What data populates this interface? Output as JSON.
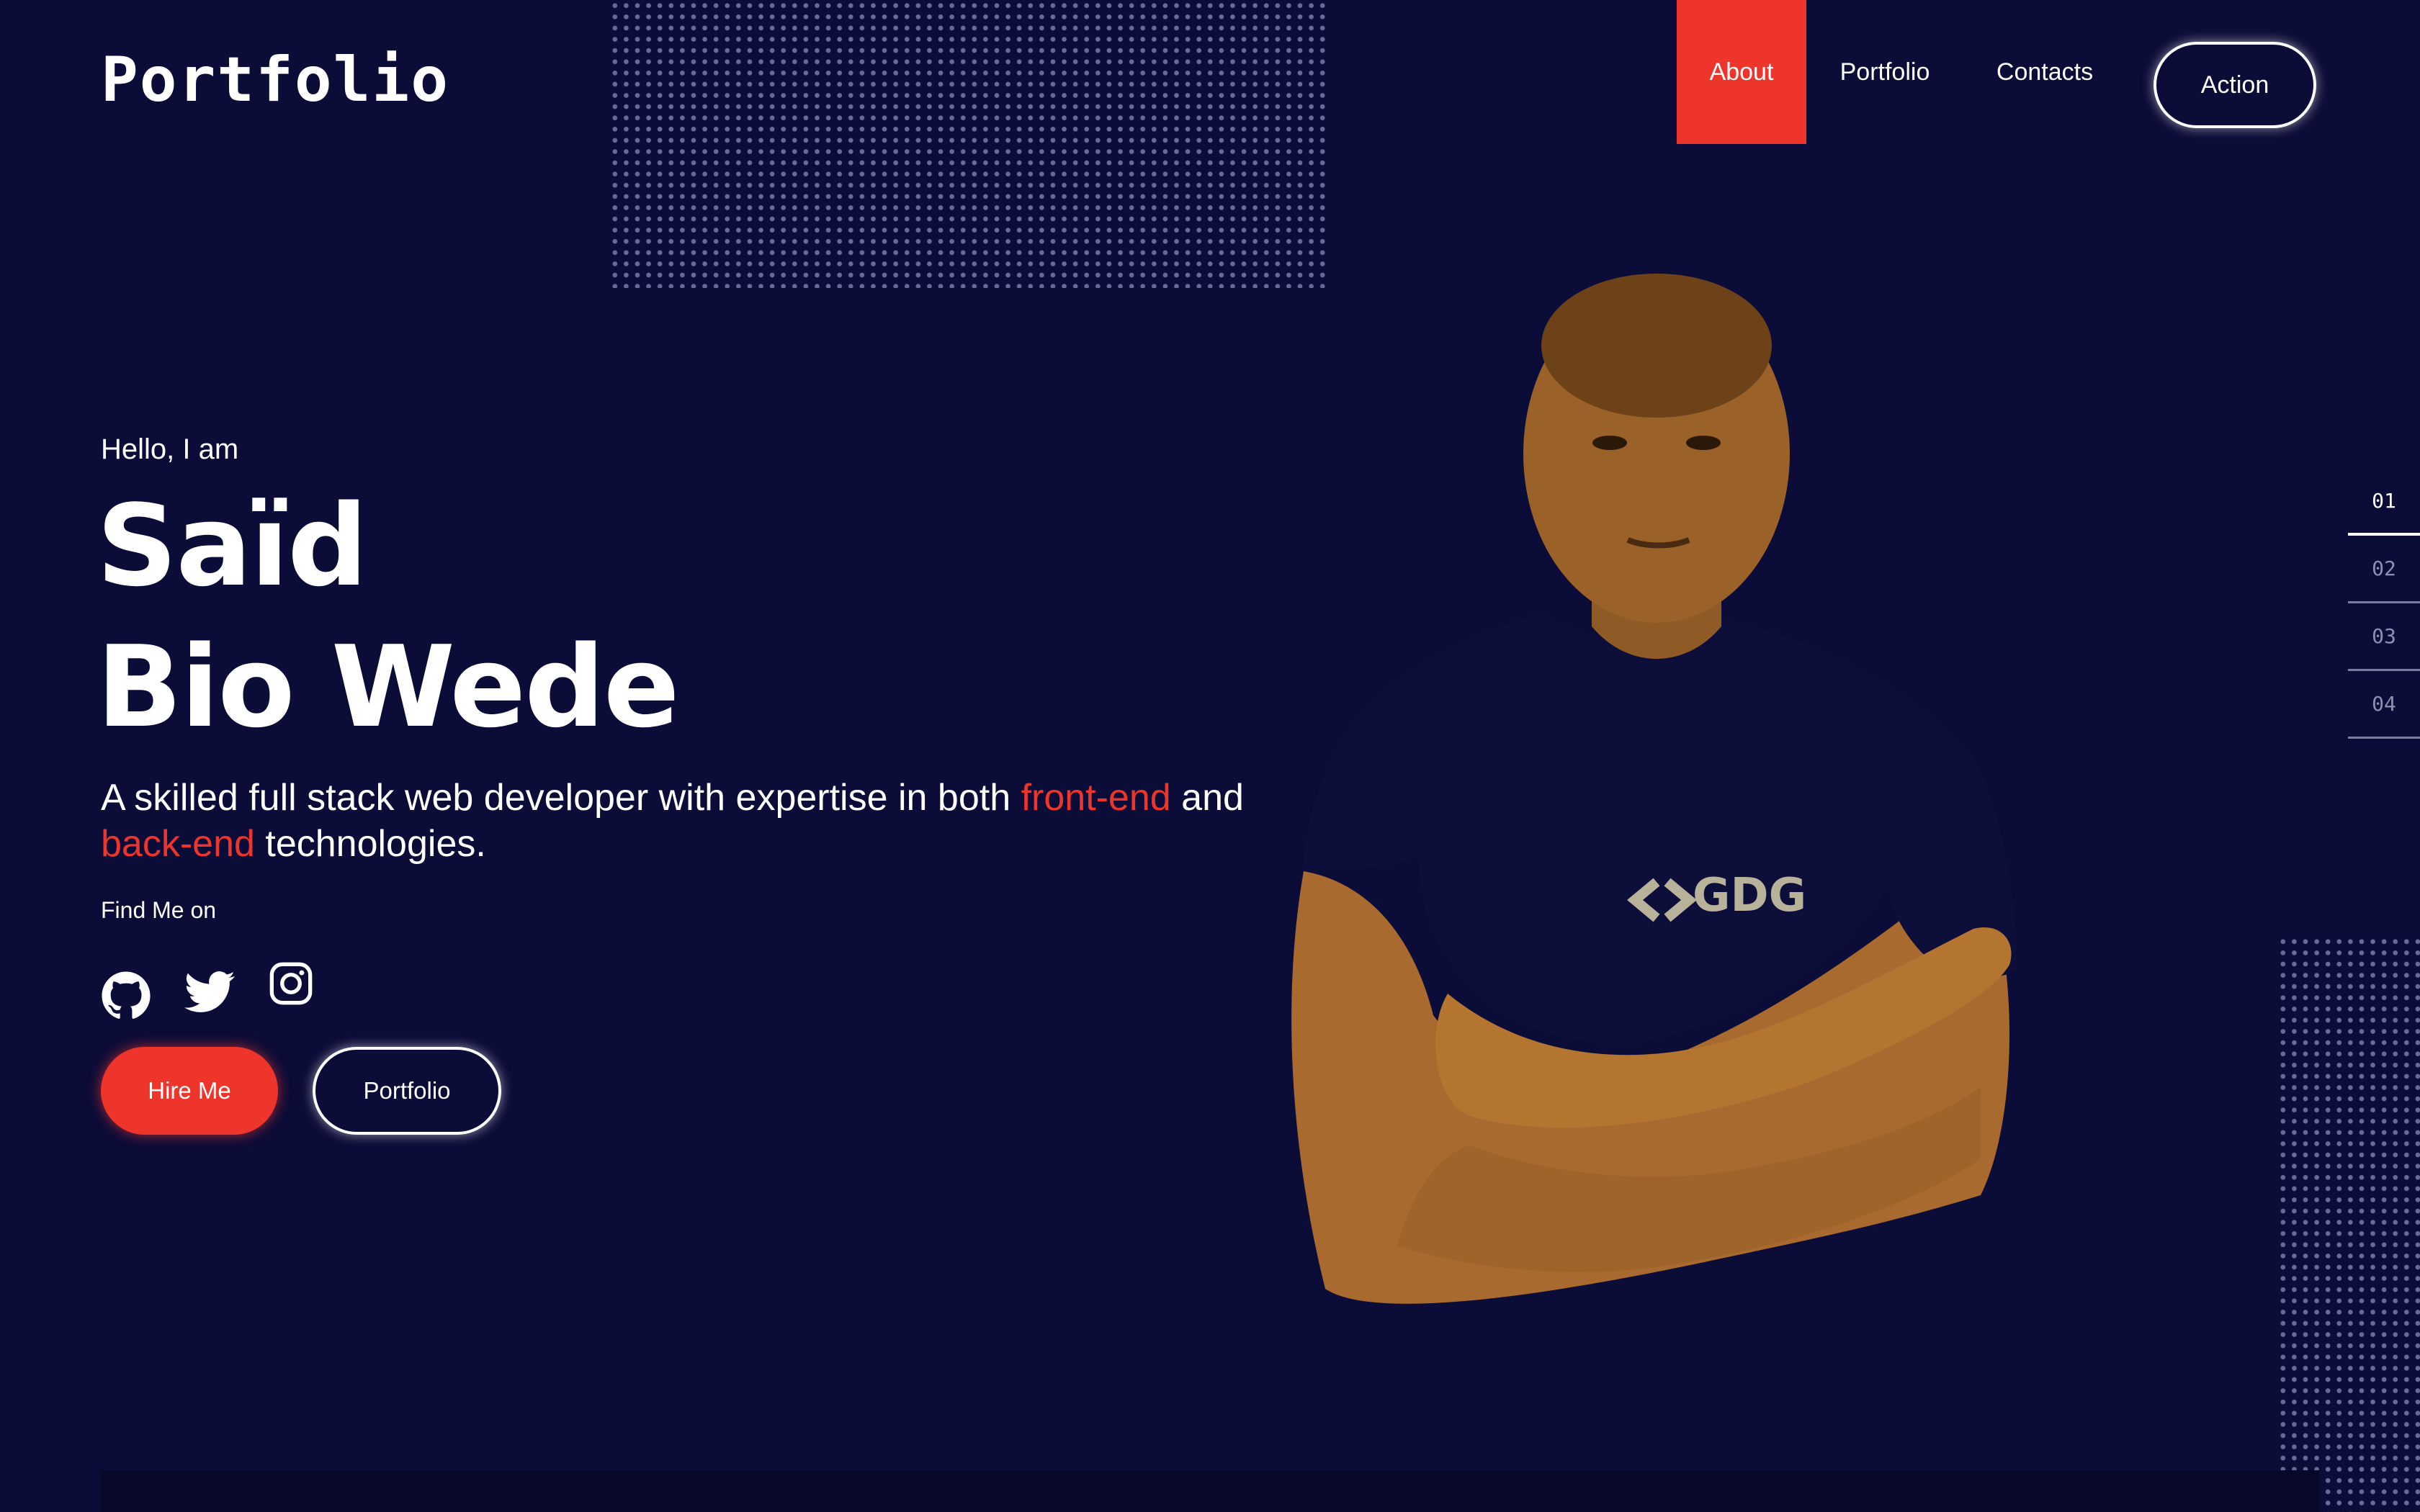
{
  "brand": {
    "logo": "Portfolio"
  },
  "nav": {
    "items": [
      {
        "label": "About",
        "active": true
      },
      {
        "label": "Portfolio",
        "active": false
      },
      {
        "label": "Contacts",
        "active": false
      }
    ],
    "action_label": "Action"
  },
  "hero": {
    "greeting": "Hello, I am",
    "name_line1": "Saïd",
    "name_line2": "Bio Wede",
    "tagline_parts": [
      "A skilled full stack web developer with expertise in both ",
      "front-end",
      " and ",
      "back-end",
      " technologies."
    ],
    "find_me": "Find Me on",
    "socials": [
      "github-icon",
      "twitter-icon",
      "instagram-icon"
    ],
    "hire_label": "Hire Me",
    "portfolio_label": "Portfolio"
  },
  "portrait": {
    "shirt_text": "GDG"
  },
  "pager": {
    "items": [
      "01",
      "02",
      "03",
      "04"
    ],
    "active_index": 0
  },
  "colors": {
    "background": "#0c0c38",
    "accent": "#ee352b",
    "text": "#ffffff"
  }
}
